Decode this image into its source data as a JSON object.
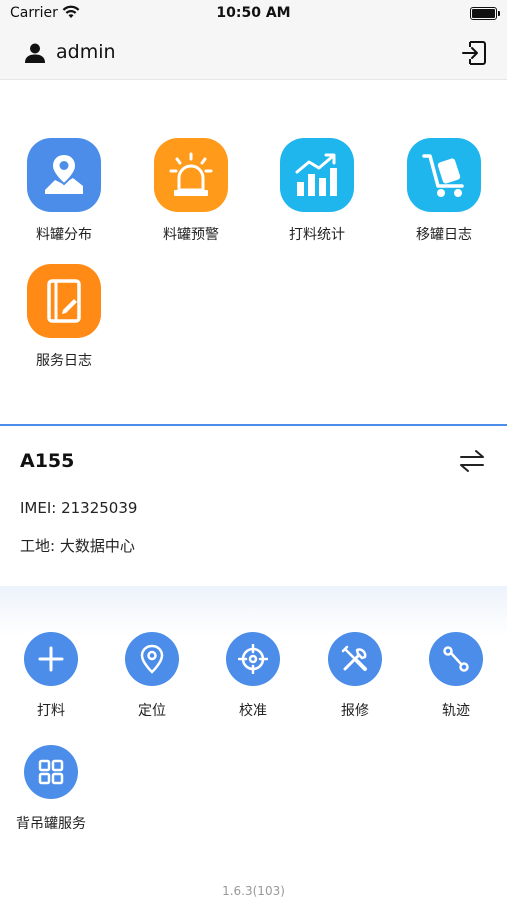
{
  "status_bar": {
    "carrier": "Carrier",
    "time": "10:50 AM"
  },
  "header": {
    "username": "admin",
    "user_icon": "user-icon",
    "logout_icon": "logout-icon"
  },
  "menu": [
    {
      "label": "料罐分布",
      "icon": "map-pin-icon",
      "color": "#4b8de8"
    },
    {
      "label": "料罐预警",
      "icon": "alarm-siren-icon",
      "color": "#ff9a1a"
    },
    {
      "label": "打料统计",
      "icon": "bar-chart-icon",
      "color": "#1fb6ee"
    },
    {
      "label": "移罐日志",
      "icon": "hand-truck-icon",
      "color": "#1fb6ee"
    },
    {
      "label": "服务日志",
      "icon": "notebook-icon",
      "color": "#ff8a16"
    }
  ],
  "device": {
    "name": "A155",
    "imei": "IMEI: 21325039",
    "site": "工地: 大数据中心",
    "swap_icon": "swap-arrows-icon"
  },
  "actions": [
    {
      "label": "打料",
      "icon": "plus-icon"
    },
    {
      "label": "定位",
      "icon": "location-pin-icon"
    },
    {
      "label": "校准",
      "icon": "crosshair-icon"
    },
    {
      "label": "报修",
      "icon": "repair-tools-icon"
    },
    {
      "label": "轨迹",
      "icon": "route-icon"
    },
    {
      "label": "背吊罐服务",
      "icon": "grid-icon"
    }
  ],
  "version": "1.6.3(103)",
  "colors": {
    "accent": "#4b8de8",
    "orange": "#ff9a1a",
    "cyan": "#1fb6ee"
  }
}
